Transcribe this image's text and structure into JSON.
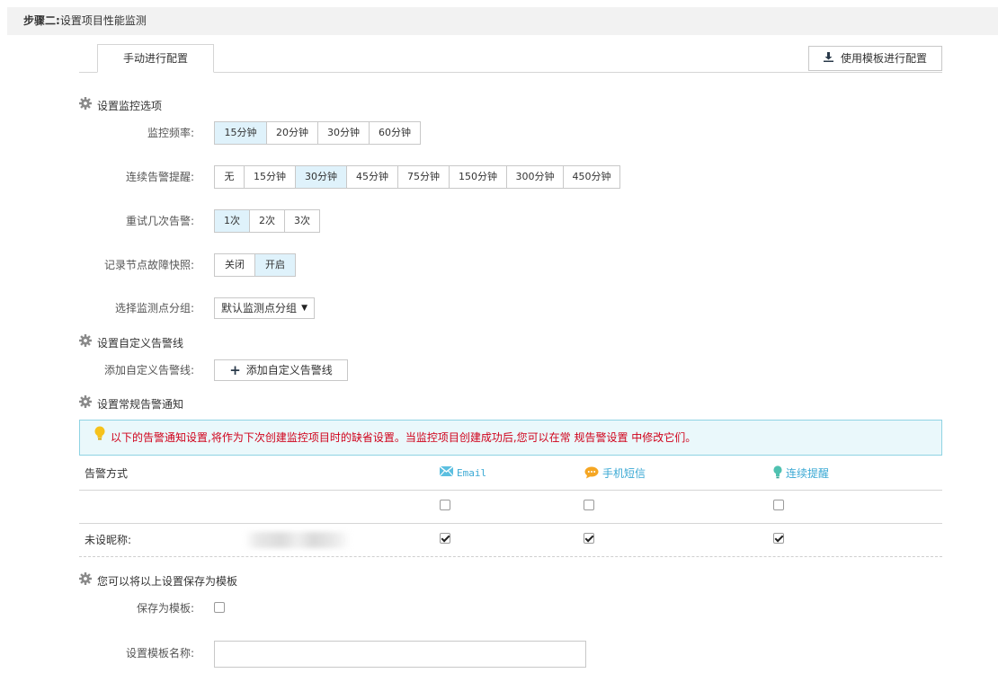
{
  "step": {
    "label": "步骤二:",
    "title": "设置项目性能监测"
  },
  "tabs": {
    "manual_label": "手动进行配置",
    "template_button_label": "使用模板进行配置"
  },
  "sections": {
    "monitor_options": "设置监控选项",
    "custom_alert_line": "设置自定义告警线",
    "regular_notification": "设置常规告警通知",
    "save_template": "您可以将以上设置保存为模板"
  },
  "monitor": {
    "frequency": {
      "label": "监控频率:",
      "options": [
        "15分钟",
        "20分钟",
        "30分钟",
        "60分钟"
      ],
      "selected": "15分钟"
    },
    "continuous_alert": {
      "label": "连续告警提醒:",
      "options": [
        "无",
        "15分钟",
        "30分钟",
        "45分钟",
        "75分钟",
        "150分钟",
        "300分钟",
        "450分钟"
      ],
      "selected": "30分钟"
    },
    "retry": {
      "label": "重试几次告警:",
      "options": [
        "1次",
        "2次",
        "3次"
      ],
      "selected": "1次"
    },
    "snapshot": {
      "label": "记录节点故障快照:",
      "options": [
        "关闭",
        "开启"
      ],
      "selected": "开启"
    },
    "group": {
      "label": "选择监测点分组:",
      "value": "默认监测点分组"
    }
  },
  "custom_alert": {
    "label": "添加自定义告警线:",
    "button_label": "添加自定义告警线"
  },
  "notification": {
    "tip": "以下的告警通知设置,将作为下次创建监控项目时的缺省设置。当监控项目创建成功后,您可以在常 规告警设置 中修改它们。",
    "table": {
      "header_first": "告警方式",
      "channels": [
        {
          "label": "Email",
          "icon": "email-icon"
        },
        {
          "label": "手机短信",
          "icon": "sms-icon"
        },
        {
          "label": "连续提醒",
          "icon": "bulb-icon"
        }
      ],
      "select_all_checked": [
        false,
        false,
        false
      ],
      "rows": [
        {
          "name": "未设昵称:",
          "checked": [
            true,
            true,
            true
          ]
        }
      ]
    }
  },
  "template": {
    "save_label": "保存为模板:",
    "save_checked": false,
    "name_label": "设置模板名称:",
    "name_value": ""
  },
  "colors": {
    "selected_bg": "#dff2fb",
    "tip_text": "#d0021b",
    "tip_bg": "#eaf8fb",
    "channel_text": "#3ba9d4"
  }
}
